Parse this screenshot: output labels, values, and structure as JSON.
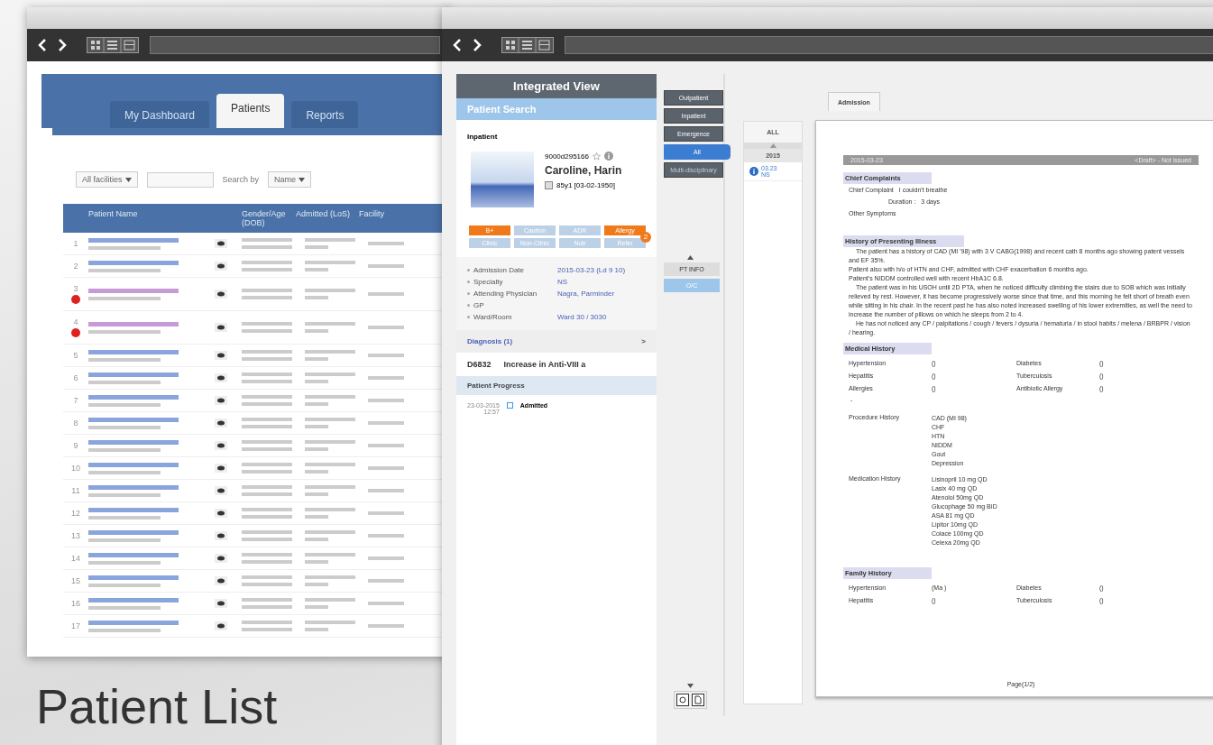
{
  "list_window": {
    "tabs": [
      {
        "label": "My Dashboard",
        "selected": false
      },
      {
        "label": "Patients",
        "selected": true
      },
      {
        "label": "Reports",
        "selected": false
      }
    ],
    "filters": {
      "facility": "All facilities",
      "search_by_label": "Search by",
      "search_by": "Name"
    },
    "columns": [
      "Patient Name",
      "Gender/Age (DOB)",
      "Admitted (LoS)",
      "Facility"
    ],
    "rows": [
      {
        "number": "1",
        "flagged": false
      },
      {
        "number": "2",
        "flagged": false
      },
      {
        "number": "3",
        "flagged": true
      },
      {
        "number": "4",
        "flagged": true
      },
      {
        "number": "5",
        "flagged": false
      },
      {
        "number": "6",
        "flagged": false
      },
      {
        "number": "7",
        "flagged": false
      },
      {
        "number": "8",
        "flagged": false
      },
      {
        "number": "9",
        "flagged": false
      },
      {
        "number": "10",
        "flagged": false
      },
      {
        "number": "11",
        "flagged": false
      },
      {
        "number": "12",
        "flagged": false
      },
      {
        "number": "13",
        "flagged": false
      },
      {
        "number": "14",
        "flagged": false
      },
      {
        "number": "15",
        "flagged": false
      },
      {
        "number": "16",
        "flagged": false
      },
      {
        "number": "17",
        "flagged": false
      }
    ]
  },
  "caption": "Patient List",
  "view_window": {
    "panel": {
      "title": "Integrated View",
      "search": "Patient Search",
      "section": "Inpatient",
      "patient_id": "9000d295166",
      "name": "Caroline, Harin",
      "age": "85y1 [03-02-1950]",
      "tags": [
        {
          "label": "B+",
          "active": true
        },
        {
          "label": "Caution",
          "active": false
        },
        {
          "label": "ADR",
          "active": false
        },
        {
          "label": "Allergy",
          "active": true,
          "badge": "2"
        },
        {
          "label": "Clinic",
          "active": false
        },
        {
          "label": "Non-Clinic",
          "active": false
        },
        {
          "label": "Nutr",
          "active": false
        },
        {
          "label": "Refer",
          "active": false
        }
      ],
      "details": [
        {
          "label": "Admission Date",
          "value": "2015-03-23 (Ld 9 10)"
        },
        {
          "label": "Specialty",
          "value": "NS"
        },
        {
          "label": "Attending Physician",
          "value": "Nagra, Parminder"
        },
        {
          "label": "GP"
        },
        {
          "label": "Ward/Room",
          "value": "Ward 30 / 3030"
        }
      ],
      "diagnosis_header": "Diagnosis (1)",
      "diagnosis_chevron": ">",
      "diagnosis": {
        "code": "D6832",
        "text": "Increase in Anti-VIII a"
      },
      "progress_header": "Patient Progress",
      "progress": [
        {
          "date": "23-03-2015",
          "time": "12:57",
          "event": "Admitted"
        }
      ]
    },
    "nav": [
      {
        "label": "Outpatient",
        "selected": false,
        "disabled": false
      },
      {
        "label": "Inpatient",
        "selected": false,
        "disabled": false
      },
      {
        "label": "Emergence",
        "selected": false,
        "disabled": false
      },
      {
        "label": "All",
        "selected": true,
        "disabled": false
      },
      {
        "label": "Multi-disciplinary",
        "selected": false,
        "disabled": true
      }
    ],
    "views": [
      {
        "label": "PT INFO",
        "selected": false
      },
      {
        "label": "O/C",
        "selected": true
      }
    ],
    "timeline": {
      "header": "ALL",
      "year": "2015",
      "entries": [
        {
          "date": "03.23",
          "specialty": "NS"
        }
      ]
    },
    "doc_tab": "Admission",
    "document": {
      "date": "2015-03-23",
      "status": "<Draft> - Not issued",
      "chief": {
        "title": "Chief Complaints",
        "fields": [
          {
            "label": "Chief Complaint",
            "value": "I couldn't breathe"
          },
          {
            "label": "Duration :",
            "value": "3 days"
          },
          {
            "label": "Other Symptoms"
          }
        ]
      },
      "hpi": {
        "title": "History of Presenting Illness",
        "paragraphs": [
          "The patient has a history of CAD (MI '98) with 3 V CABG(1998) and recent cath 8 months ago showing patent vessels and EF 35%.",
          "Patient also with h/o of HTN and CHF, admitted with CHF exacerbation 6 months ago.",
          "Patient's NIDDM controlled well with recent HbA1C 6.8.",
          "The patient was in his USOH until 2D PTA, when he noticed difficulty climbing the stairs due to SOB which was initially relieved by rest. However, it has become progressively worse since that time, and this morning he felt short of breath even while sitting in his chair. In the recent past he has also noted increased swelling of his lower extremities, as well the need to increase the number of pillows on which he sleeps from 2 to 4.",
          "He has not noticed any CP / palpitations / cough / fevers / dysuria / hematuria / in stool habits / melena / BRBPR / vision / hearing."
        ]
      },
      "medical": {
        "title": "Medical History",
        "items": [
          {
            "label": "Hypertension",
            "value": "()"
          },
          {
            "label": "Diabetes",
            "value": "()"
          },
          {
            "label": "Hepatitis",
            "value": "()"
          },
          {
            "label": "Tuberculosis",
            "value": "()"
          },
          {
            "label": "Allergies",
            "value": "()"
          },
          {
            "label": "Antibiotic Allergy",
            "value": "()"
          }
        ],
        "dash": "-",
        "lists": [
          {
            "label": "Procedure History",
            "values": [
              "CAD (MI 98)",
              "CHF",
              "HTN",
              "NIDDM",
              "Gout",
              "Depression"
            ]
          },
          {
            "label": "Medication History",
            "values": [
              "Lisinopril 10 mg QD",
              "Lasix 40 mg QD",
              "Atenolol 50mg QD",
              "Glucophage 50 mg BID",
              "ASA 81 mg QD",
              "Lipitor 10mg QD",
              "Colace 100mg QD",
              "Celexa 20mg QD"
            ]
          }
        ]
      },
      "family": {
        "title": "Family History",
        "items": [
          {
            "label": "Hypertension",
            "value": "(Ma )"
          },
          {
            "label": "Diabetes",
            "value": "()"
          },
          {
            "label": "Hepatitis",
            "value": "()"
          },
          {
            "label": "Tuberculosis",
            "value": "()"
          }
        ]
      },
      "page": "Page(1/2)"
    }
  }
}
